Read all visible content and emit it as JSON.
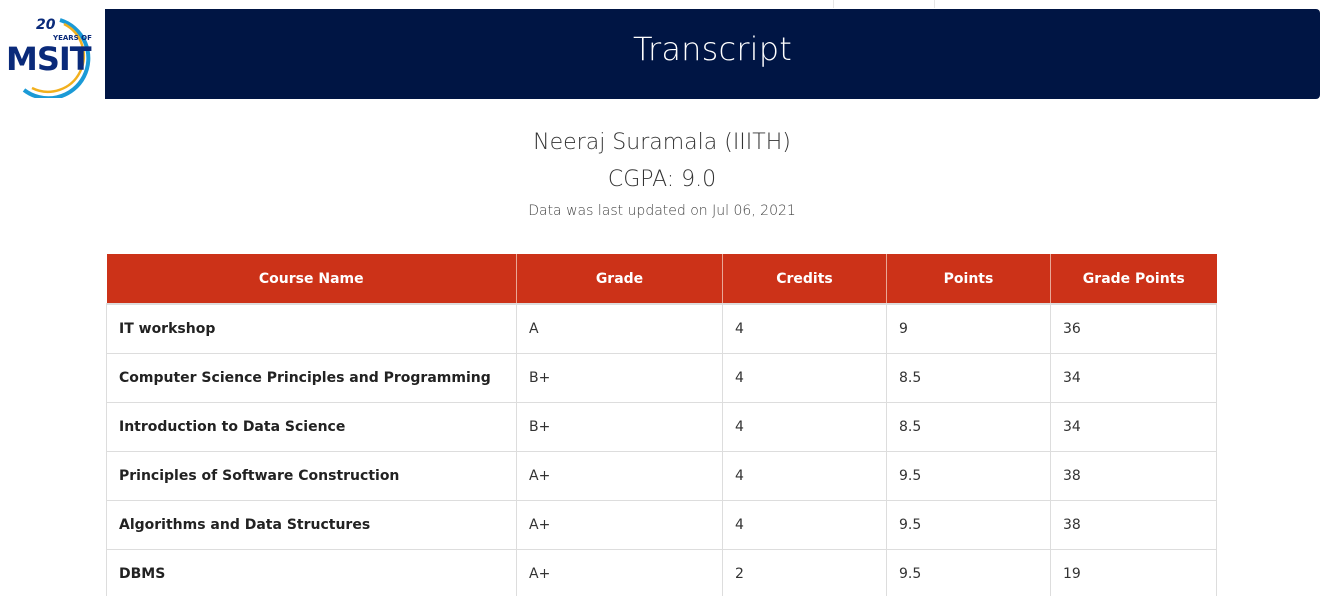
{
  "logo": {
    "anniversary_number": "20",
    "anniversary_text": "YEARS OF",
    "brand": "MSIT"
  },
  "header": {
    "title": "Transcript"
  },
  "student": {
    "name": "Neeraj Suramala (IIITH)",
    "cgpa": "CGPA: 9.0",
    "updated": "Data was last updated on Jul 06, 2021"
  },
  "colors": {
    "banner": "#001544",
    "table_header": "#cc3218"
  },
  "table": {
    "headers": [
      "Course Name",
      "Grade",
      "Credits",
      "Points",
      "Grade Points"
    ],
    "rows": [
      [
        "IT workshop",
        "A",
        "4",
        "9",
        "36"
      ],
      [
        "Computer Science Principles and Programming",
        "B+",
        "4",
        "8.5",
        "34"
      ],
      [
        "Introduction to Data Science",
        "B+",
        "4",
        "8.5",
        "34"
      ],
      [
        "Principles of Software Construction",
        "A+",
        "4",
        "9.5",
        "38"
      ],
      [
        "Algorithms and Data Structures",
        "A+",
        "4",
        "9.5",
        "38"
      ],
      [
        "DBMS",
        "A+",
        "2",
        "9.5",
        "19"
      ]
    ]
  }
}
